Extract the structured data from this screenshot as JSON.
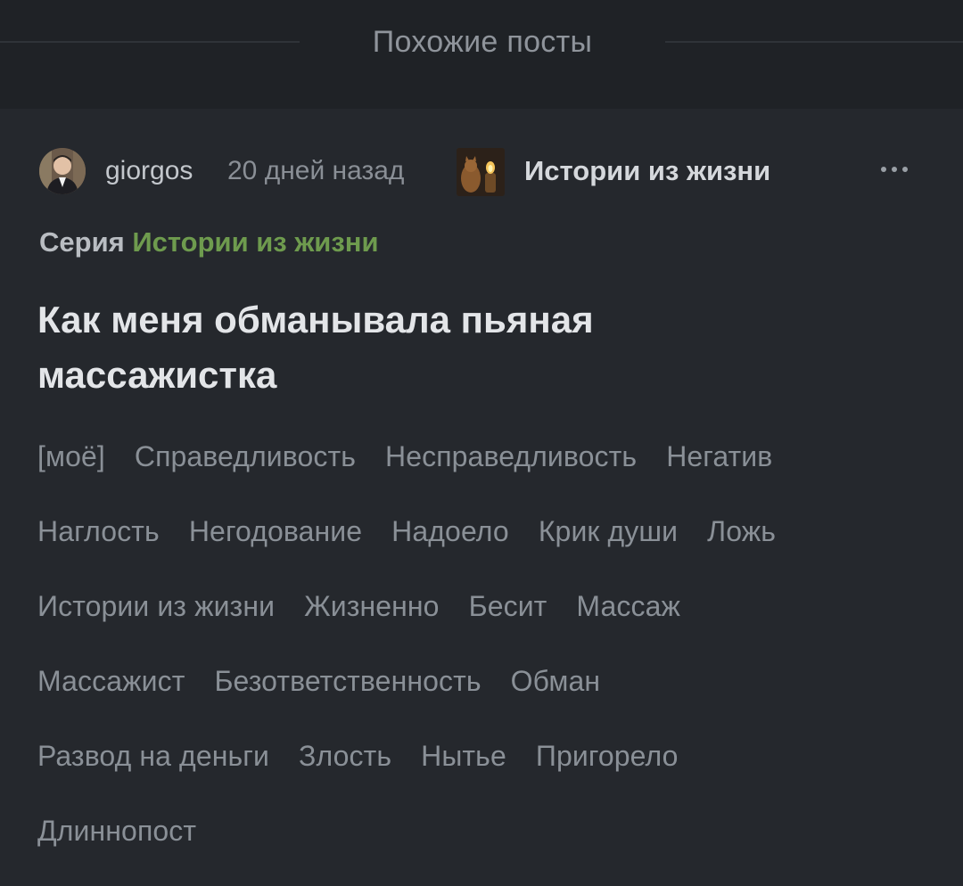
{
  "section": {
    "title": "Похожие посты"
  },
  "post": {
    "author": "giorgos",
    "time": "20 дней назад",
    "community": "Истории из жизни",
    "series_label": "Серия",
    "series_link": "Истории из жизни",
    "title": "Как меня обманывала пьяная массажистка",
    "tags": [
      "[моё]",
      "Справедливость",
      "Несправедливость",
      "Негатив",
      "Наглость",
      "Негодование",
      "Надоело",
      "Крик души",
      "Ложь",
      "Истории из жизни",
      "Жизненно",
      "Бесит",
      "Массаж",
      "Массажист",
      "Безответственность",
      "Обман",
      "Развод на деньги",
      "Злость",
      "Нытье",
      "Пригорело",
      "Длиннопост"
    ]
  },
  "icons": {
    "more": "more-horizontal-icon"
  },
  "colors": {
    "background": "#1f2226",
    "card": "#25282d",
    "series_link": "#6e9b4e",
    "tag_text": "#8a9097",
    "title_text": "#e3e5e8"
  }
}
